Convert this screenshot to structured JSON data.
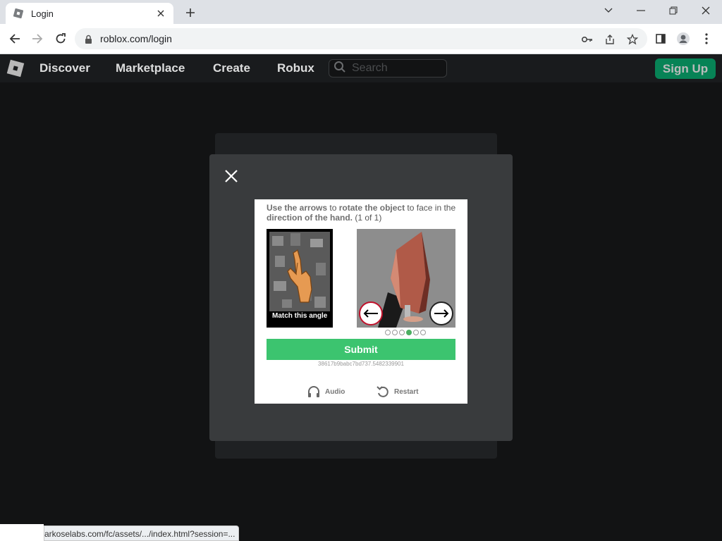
{
  "browser": {
    "tab_title": "Login",
    "url": "roblox.com/login",
    "status_url": "arkoselabs.com/fc/assets/.../index.html?session=..."
  },
  "nav": {
    "links": [
      "Discover",
      "Marketplace",
      "Create",
      "Robux"
    ],
    "search_placeholder": "Search",
    "signup_label": "Sign Up"
  },
  "challenge": {
    "instruction_parts": [
      {
        "text": "Use the arrows",
        "bold": true
      },
      {
        "text": " to ",
        "bold": false
      },
      {
        "text": "rotate the object",
        "bold": true
      },
      {
        "text": " to face in the ",
        "bold": false
      },
      {
        "text": "direction of the hand.",
        "bold": true
      },
      {
        "text": " (1 of 1)",
        "bold": false
      }
    ],
    "reference_label": "Match this angle",
    "dots_total": 6,
    "dots_active_index": 3,
    "submit_label": "Submit",
    "session_id": "38617b9babc7bd737.5482339901",
    "audio_label": "Audio",
    "restart_label": "Restart"
  },
  "colors": {
    "submit": "#3cc46f",
    "signup": "#00b06f",
    "modal_bg": "#393b3d",
    "left_arrow_ring": "#c0102a"
  }
}
